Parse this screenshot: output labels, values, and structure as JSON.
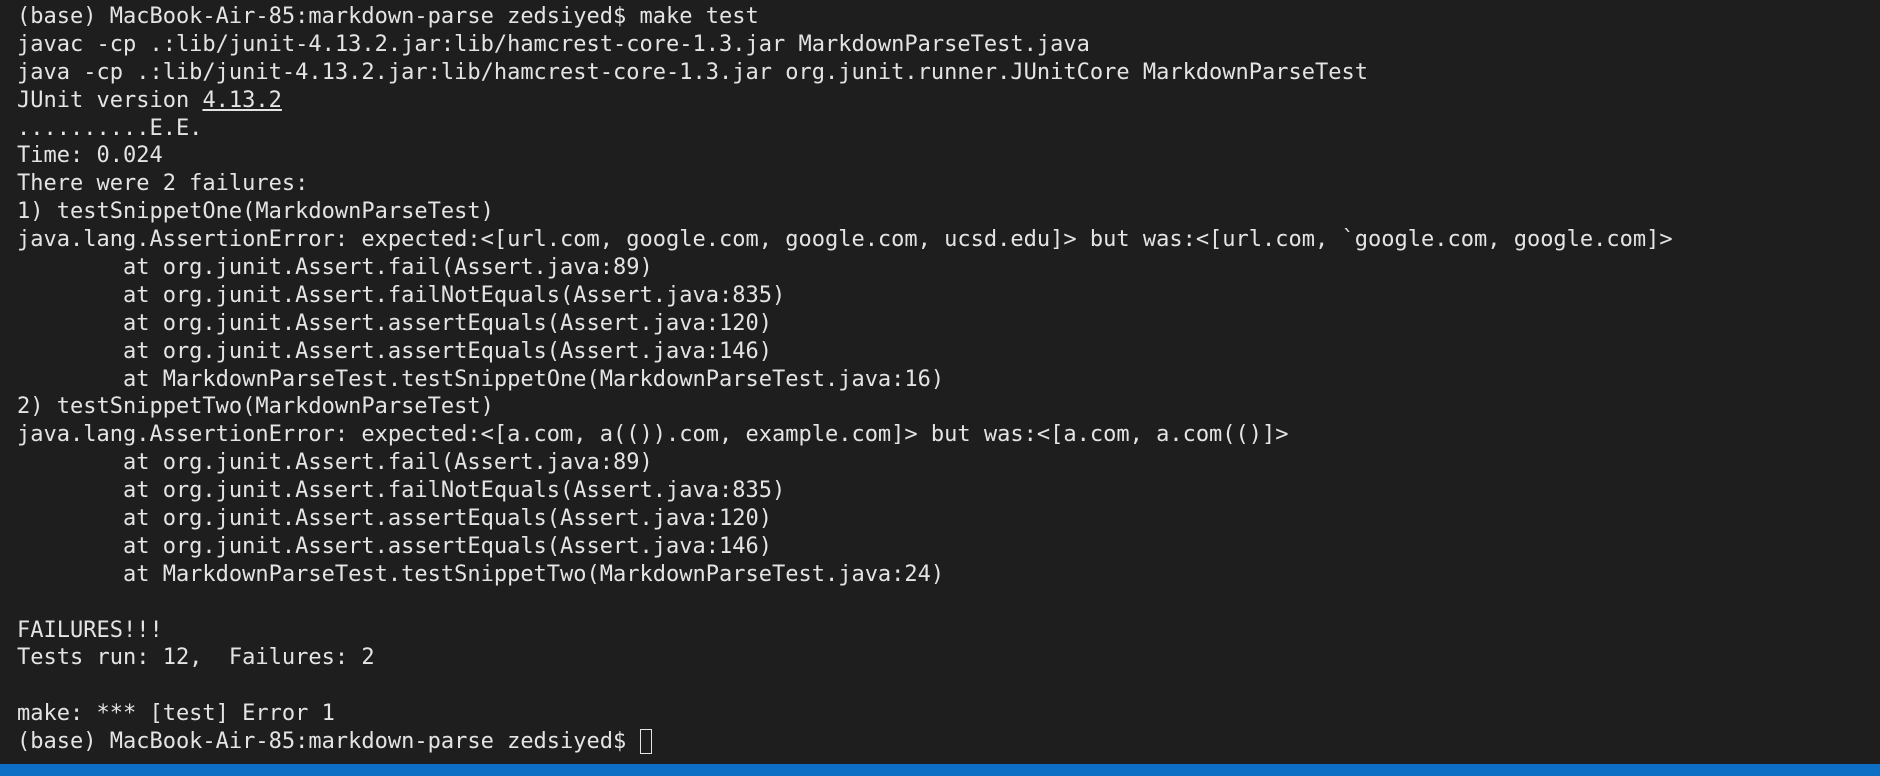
{
  "terminal": {
    "lines": [
      "(base) MacBook-Air-85:markdown-parse zedsiyed$ make test",
      "javac -cp .:lib/junit-4.13.2.jar:lib/hamcrest-core-1.3.jar MarkdownParseTest.java",
      "java -cp .:lib/junit-4.13.2.jar:lib/hamcrest-core-1.3.jar org.junit.runner.JUnitCore MarkdownParseTest",
      "JUnit version ",
      "..........E.E.",
      "Time: 0.024",
      "There were 2 failures:",
      "1) testSnippetOne(MarkdownParseTest)",
      "java.lang.AssertionError: expected:<[url.com, google.com, google.com, ucsd.edu]> but was:<[url.com, `google.com, google.com]>",
      "        at org.junit.Assert.fail(Assert.java:89)",
      "        at org.junit.Assert.failNotEquals(Assert.java:835)",
      "        at org.junit.Assert.assertEquals(Assert.java:120)",
      "        at org.junit.Assert.assertEquals(Assert.java:146)",
      "        at MarkdownParseTest.testSnippetOne(MarkdownParseTest.java:16)",
      "2) testSnippetTwo(MarkdownParseTest)",
      "java.lang.AssertionError: expected:<[a.com, a(()).com, example.com]> but was:<[a.com, a.com(()]>",
      "        at org.junit.Assert.fail(Assert.java:89)",
      "        at org.junit.Assert.failNotEquals(Assert.java:835)",
      "        at org.junit.Assert.assertEquals(Assert.java:120)",
      "        at org.junit.Assert.assertEquals(Assert.java:146)",
      "        at MarkdownParseTest.testSnippetTwo(MarkdownParseTest.java:24)",
      "",
      "FAILURES!!!",
      "Tests run: 12,  Failures: 2",
      "",
      "make: *** [test] Error 1",
      "(base) MacBook-Air-85:markdown-parse zedsiyed$ "
    ],
    "junit_version": "4.13.2"
  },
  "colors": {
    "background": "#1e1e1e",
    "text": "#e4e4e4",
    "status_bar": "#0e70c4"
  }
}
